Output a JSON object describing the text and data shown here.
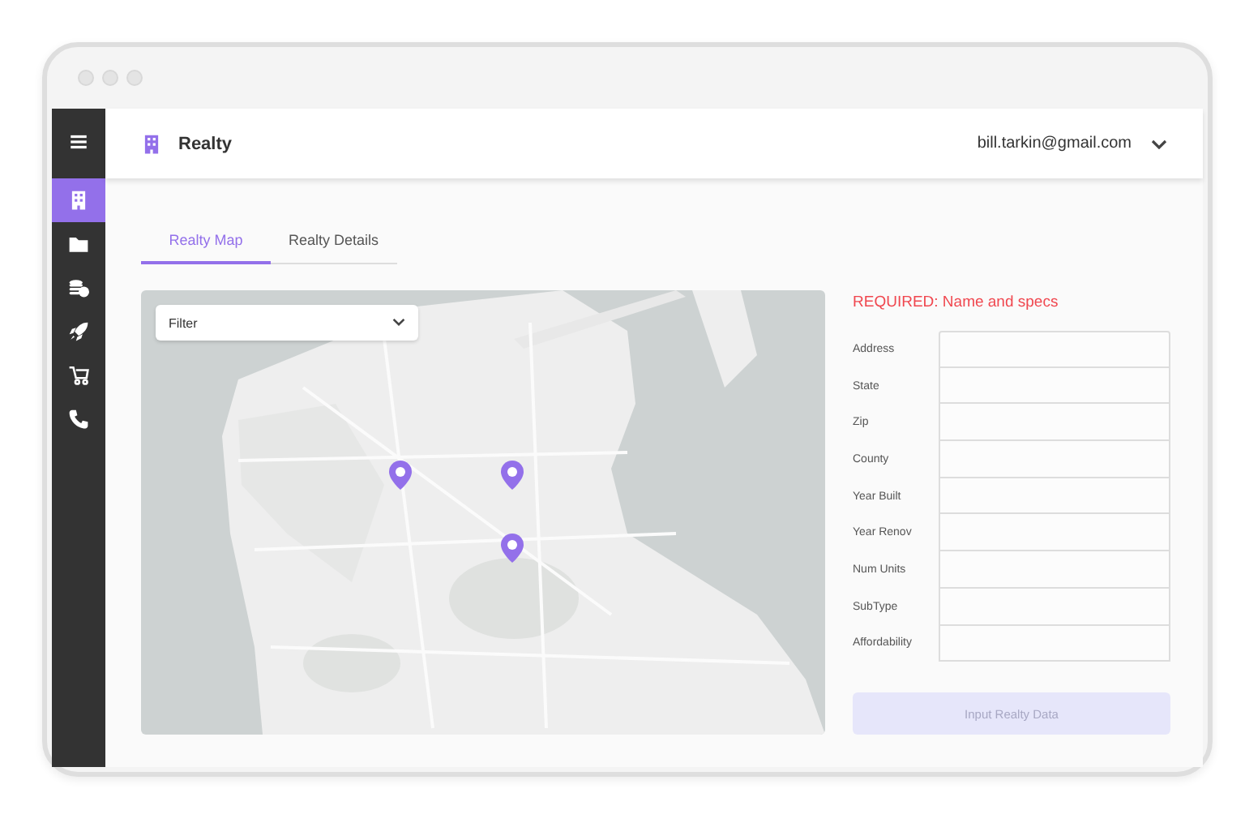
{
  "sidebar": {
    "items": [
      {
        "kind": "menu",
        "selected": false
      },
      {
        "kind": "building",
        "selected": true
      },
      {
        "kind": "folder",
        "selected": false
      },
      {
        "kind": "coins",
        "selected": false
      },
      {
        "kind": "rocket",
        "selected": false
      },
      {
        "kind": "cart",
        "selected": false
      },
      {
        "kind": "phone",
        "selected": false
      }
    ]
  },
  "header": {
    "title": "Realty",
    "user": "bill.tarkin@gmail.com"
  },
  "tabs": [
    {
      "label": "Realty Map",
      "selected": true
    },
    {
      "label": "Realty Details",
      "selected": false
    }
  ],
  "map": {
    "filter": {
      "placeholder": "Filter"
    }
  },
  "form": {
    "notice": "REQUIRED: Name and specs",
    "fields": [
      {
        "label": "Address"
      },
      {
        "label": "State"
      },
      {
        "label": "Zip"
      },
      {
        "label": "County"
      },
      {
        "label": "Year Built"
      },
      {
        "label": "Year Renov"
      },
      {
        "label": "Num Units"
      },
      {
        "label": "SubType"
      },
      {
        "label": "Affordability"
      }
    ],
    "button": {
      "label": "Input Realty Data",
      "disabled": true
    }
  }
}
